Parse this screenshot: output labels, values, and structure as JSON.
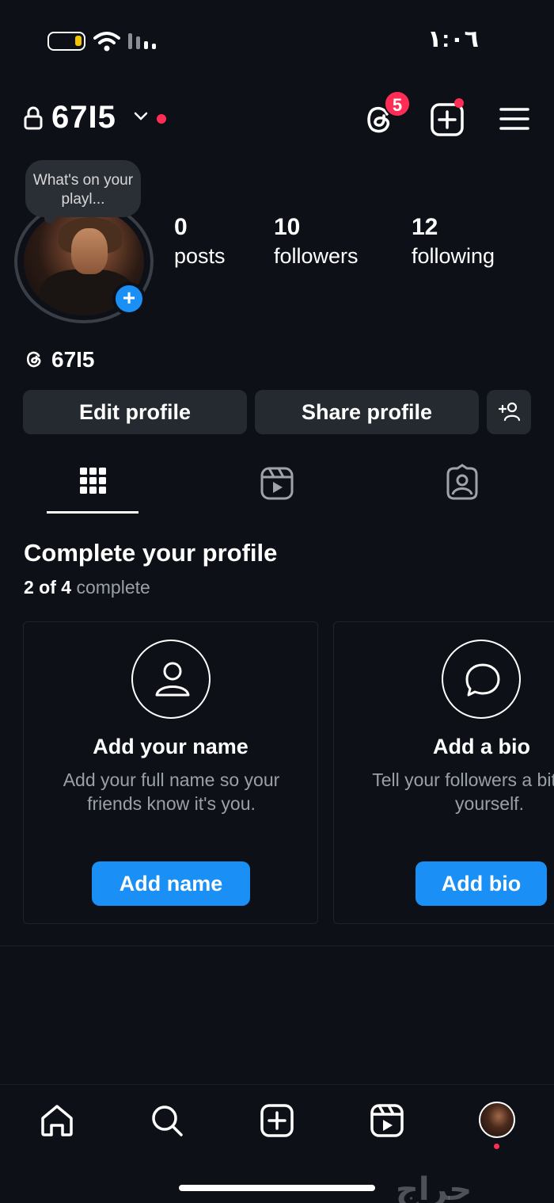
{
  "status_bar": {
    "time": "١:٠٦"
  },
  "header": {
    "username": "67I5",
    "threads_badge": "5"
  },
  "profile": {
    "note": "What's on your playl...",
    "stats": {
      "posts": {
        "value": "0",
        "label": "posts"
      },
      "followers": {
        "value": "10",
        "label": "followers"
      },
      "following": {
        "value": "12",
        "label": "following"
      }
    },
    "threads_handle": "67I5"
  },
  "actions": {
    "edit_profile": "Edit profile",
    "share_profile": "Share profile"
  },
  "tabs": [
    "grid",
    "reels",
    "tagged"
  ],
  "complete_profile": {
    "title": "Complete your profile",
    "progress_count": "2 of 4",
    "progress_suffix": "complete",
    "cards": [
      {
        "title": "Add your name",
        "description": "Add your full name so your friends know it's you.",
        "button": "Add name"
      },
      {
        "title": "Add a bio",
        "description": "Tell your followers a bit about yourself.",
        "button": "Add bio"
      }
    ]
  },
  "bottom_nav": [
    "home",
    "search",
    "create",
    "reels",
    "profile"
  ],
  "watermark": "حراج",
  "colors": {
    "background": "#0d1117",
    "accent_blue": "#1a8ff5",
    "notification_red": "#ff2d55",
    "button_gray": "#252a31"
  }
}
